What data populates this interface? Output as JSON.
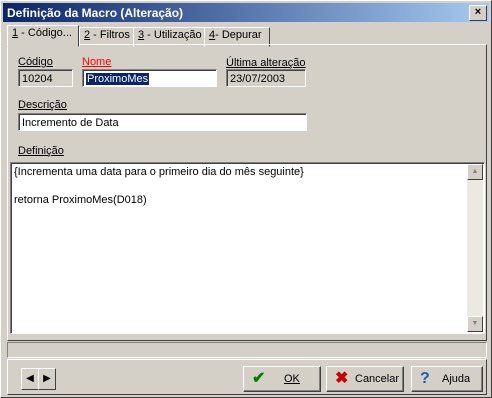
{
  "window": {
    "title": "Definição da Macro (Alteração)",
    "close_label": "×"
  },
  "tabs": [
    {
      "num": "1",
      "label": " - Código..."
    },
    {
      "num": "2",
      "label": " - Filtros"
    },
    {
      "num": "3",
      "label": " - Utilização"
    },
    {
      "num": "4",
      "label": "- Depurar"
    }
  ],
  "form": {
    "codigo_label": "Código",
    "codigo_value": "10204",
    "nome_label": "Nome",
    "nome_value": "ProximoMes",
    "ultima_label": "Última alteração",
    "ultima_value": "23/07/2003",
    "descricao_label": "Descrição",
    "descricao_value": "Incremento de Data",
    "definicao_label": "Definição",
    "definicao_value": "{Incrementa uma data para o primeiro dia do mês seguinte}\n\nretorna ProximoMes(D018)"
  },
  "buttons": {
    "ok": "OK",
    "cancelar": "Cancelar",
    "ajuda": "Ajuda",
    "prev": "◀",
    "next": "▶"
  },
  "colors": {
    "nome_label": "#ff0000",
    "ok_icon": "#008000",
    "cancel_icon": "#cc0000",
    "help_icon": "#1a5fb4"
  }
}
